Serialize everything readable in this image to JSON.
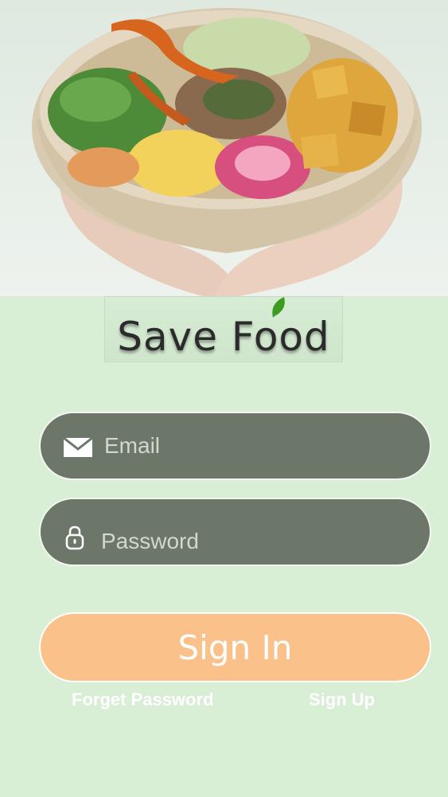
{
  "brand": {
    "name": "Save Food",
    "leaf_color": "#3d9b1f"
  },
  "hero": {
    "image": "food-bowl-held-in-hands"
  },
  "form": {
    "email": {
      "placeholder": "Email",
      "icon": "mail-icon"
    },
    "password": {
      "placeholder": "Password",
      "icon": "lock-icon"
    }
  },
  "actions": {
    "sign_in": "Sign In",
    "forget_password": "Forget Password",
    "sign_up": "Sign Up"
  },
  "colors": {
    "background": "#d8eed5",
    "field": "#6c7669",
    "button": "#fbc18a",
    "text": "#ffffff"
  }
}
